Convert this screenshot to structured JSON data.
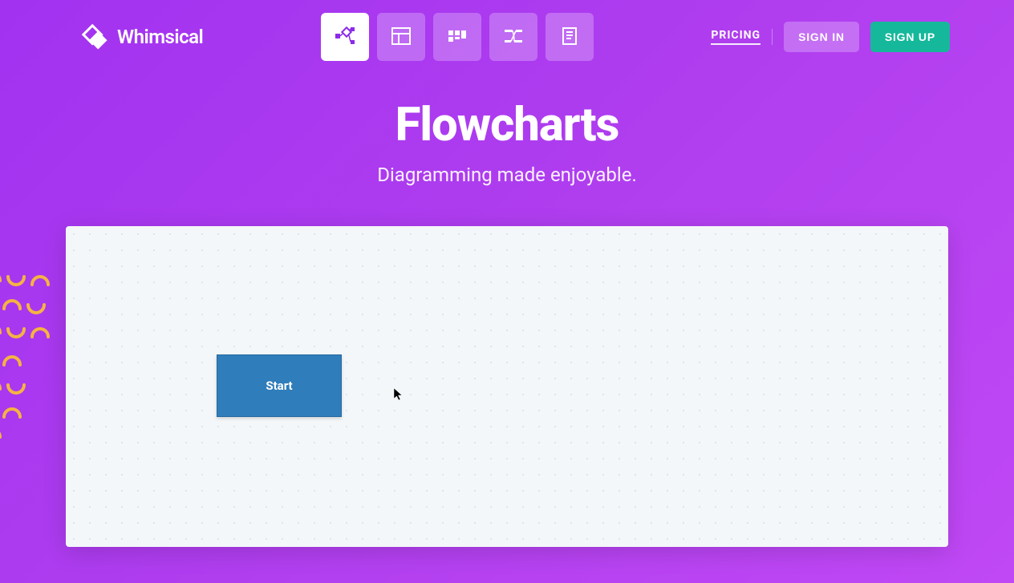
{
  "brand": "Whimsical",
  "nav": {
    "pricing": "PRICING",
    "signin": "SIGN IN",
    "signup": "SIGN UP"
  },
  "hero": {
    "title": "Flowcharts",
    "subtitle": "Diagramming made enjoyable."
  },
  "canvas": {
    "start_node": "Start"
  },
  "tools": {
    "flowcharts": "flowcharts-tool",
    "wireframes": "wireframes-tool",
    "sticky": "sticky-notes-tool",
    "mindmaps": "mind-maps-tool",
    "docs": "docs-tool"
  }
}
